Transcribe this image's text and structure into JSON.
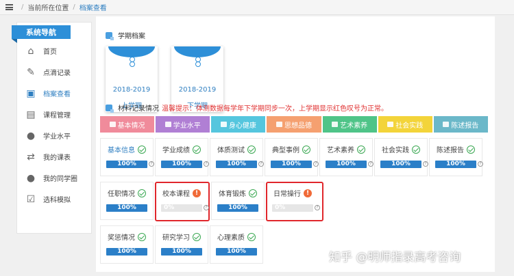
{
  "breadcrumb": {
    "location": "当前所在位置",
    "current": "档案查看"
  },
  "sidebar": {
    "title": "系统导航",
    "items": [
      {
        "label": "首页",
        "icon": "home-icon"
      },
      {
        "label": "点滴记录",
        "icon": "edit-icon"
      },
      {
        "label": "档案查看",
        "icon": "archive-icon",
        "active": true
      },
      {
        "label": "课程管理",
        "icon": "course-icon"
      },
      {
        "label": "学业水平",
        "icon": "user-icon"
      },
      {
        "label": "我的课表",
        "icon": "schedule-icon"
      },
      {
        "label": "我的同学圈",
        "icon": "users-icon"
      },
      {
        "label": "选科模拟",
        "icon": "clipboard-icon"
      }
    ]
  },
  "semester_section": {
    "title": "学期档案",
    "cards": [
      {
        "year": "2018-2019",
        "term": "上学期"
      },
      {
        "year": "2018-2019",
        "term": "下学期"
      }
    ]
  },
  "material_section": {
    "title": "材料记录情况",
    "tip": "温馨提示：体测数据每学年下学期同步一次，上学期显示红色叹号为正常。"
  },
  "tabs": [
    {
      "label": "基本情况",
      "color": "#f08b9b"
    },
    {
      "label": "学业水平",
      "color": "#b07fd4"
    },
    {
      "label": "身心健康",
      "color": "#55c6de"
    },
    {
      "label": "思想品德",
      "color": "#f5a070"
    },
    {
      "label": "艺术素养",
      "color": "#4fc488"
    },
    {
      "label": "社会实践",
      "color": "#f3d43a"
    },
    {
      "label": "陈述报告",
      "color": "#6bb8c9"
    }
  ],
  "items": [
    {
      "label": "基本信息",
      "status": "ok",
      "progress": "100%",
      "blue": true
    },
    {
      "label": "学业成绩",
      "status": "ok",
      "progress": "100%"
    },
    {
      "label": "体质测试",
      "status": "ok",
      "progress": "100%"
    },
    {
      "label": "典型事例",
      "status": "ok",
      "progress": "100%"
    },
    {
      "label": "艺术素养",
      "status": "ok",
      "progress": "100%"
    },
    {
      "label": "社会实践",
      "status": "ok",
      "progress": "100%"
    },
    {
      "label": "陈述报告",
      "status": "ok",
      "progress": "100%"
    },
    {
      "label": "任职情况",
      "status": "ok",
      "progress": "100%"
    },
    {
      "label": "校本课程",
      "status": "warn",
      "progress": "0%",
      "highlight": true
    },
    {
      "label": "体育锻炼",
      "status": "ok",
      "progress": "100%"
    },
    {
      "label": "日常操行",
      "status": "warn",
      "progress": "0%",
      "highlight": true
    },
    {
      "label": "奖惩情况",
      "status": "ok",
      "progress": "100%"
    },
    {
      "label": "研究学习",
      "status": "ok",
      "progress": "100%"
    },
    {
      "label": "心理素质",
      "status": "ok",
      "progress": "100%"
    }
  ],
  "watermark": "知乎 @明师指录高考咨询"
}
